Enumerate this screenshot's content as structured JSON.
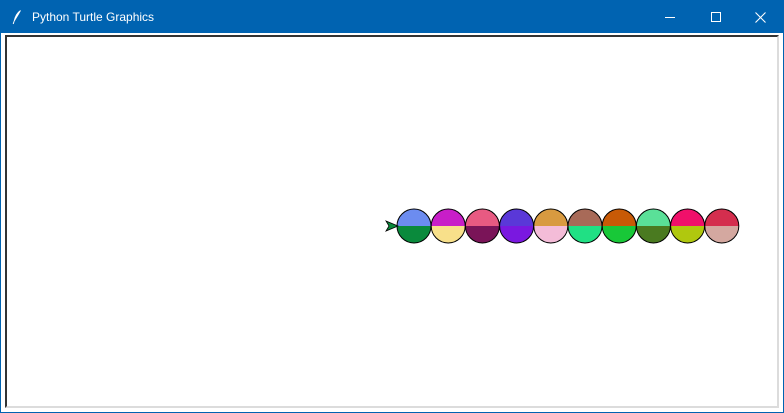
{
  "window": {
    "title": "Python Turtle Graphics",
    "icons": {
      "app": "feather-icon",
      "minimize": "minimize-icon",
      "maximize": "maximize-icon",
      "close": "close-icon"
    },
    "titlebar_color": "#0063b1"
  },
  "canvas": {
    "background": "#ffffff",
    "turtle": {
      "shape": "arrow",
      "heading": "right",
      "fill": "#0a8a3c"
    },
    "dots": [
      {
        "top": "#6c8cf0",
        "bottom": "#0a8a3c"
      },
      {
        "top": "#c81ec8",
        "bottom": "#f8e08a"
      },
      {
        "top": "#e85a82",
        "bottom": "#7a1458"
      },
      {
        "top": "#5a38d8",
        "bottom": "#7a18e0"
      },
      {
        "top": "#d89a40",
        "bottom": "#f4bcd8"
      },
      {
        "top": "#a86a58",
        "bottom": "#20e084"
      },
      {
        "top": "#c85a06",
        "bottom": "#18c838"
      },
      {
        "top": "#5ae098",
        "bottom": "#4a7a20"
      },
      {
        "top": "#f0106a",
        "bottom": "#b0c80e"
      },
      {
        "top": "#d42e4e",
        "bottom": "#d4a8a0"
      }
    ]
  }
}
